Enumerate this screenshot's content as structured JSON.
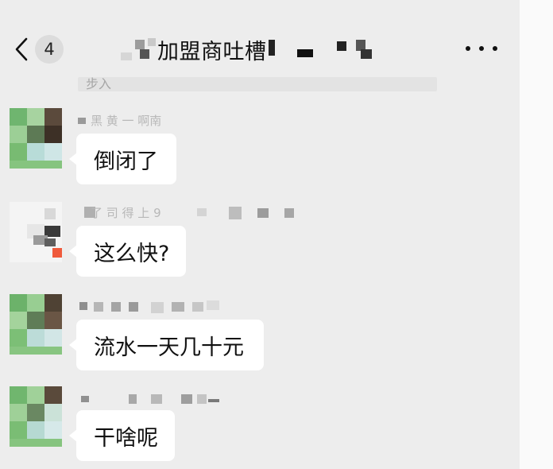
{
  "header": {
    "unread_count": "4",
    "title": "加盟商吐槽"
  },
  "pinned": {
    "text": "步入"
  },
  "messages": [
    {
      "sender": "黑 黄 一 啊南",
      "text": "倒闭了"
    },
    {
      "sender": "了 司 得 上 9",
      "text": "这么快?"
    },
    {
      "sender": "",
      "text": "流水一天几十元"
    },
    {
      "sender": "",
      "text": "干啥呢"
    }
  ]
}
